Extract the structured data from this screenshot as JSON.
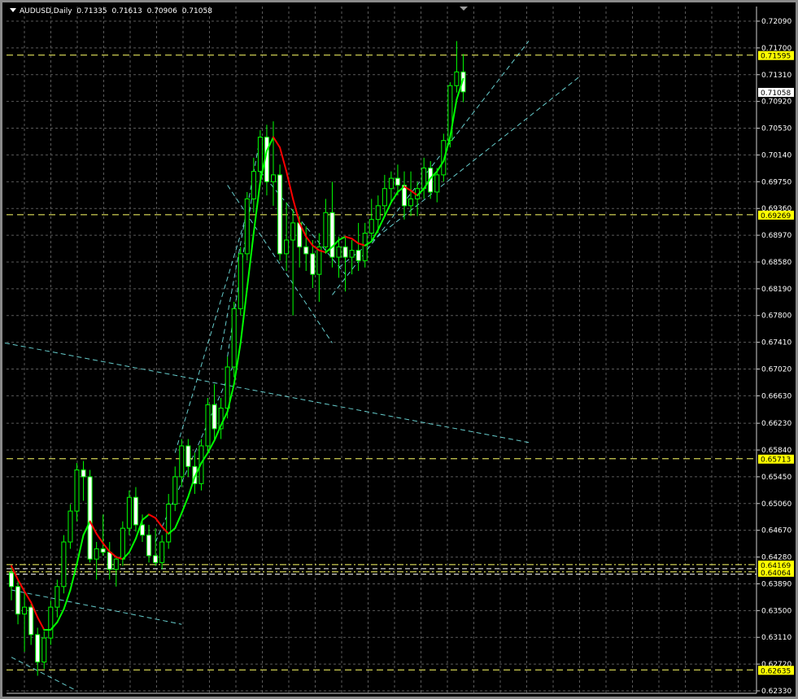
{
  "header": {
    "symbol": "AUDUSD,Daily",
    "open": "0.71335",
    "high": "0.71613",
    "low": "0.70906",
    "close": "0.71058"
  },
  "colors": {
    "background": "#000000",
    "grid": "#5a5a5a",
    "bull_candle": "#00ff00",
    "ma_up": "#00ff00",
    "ma_down": "#ff0000",
    "channel": "#66cccc",
    "hline": "#ffff66",
    "tag_bg": "#ffff00",
    "current_price_bg": "#ffffff"
  },
  "chart_data": {
    "type": "candlestick",
    "symbol": "AUDUSD",
    "timeframe": "Daily",
    "ylim": [
      0.6233,
      0.7209
    ],
    "y_ticks": [
      "0.72090",
      "0.71700",
      "0.71310",
      "0.70920",
      "0.70530",
      "0.70140",
      "0.69750",
      "0.69360",
      "0.68970",
      "0.68580",
      "0.68190",
      "0.67800",
      "0.67410",
      "0.67020",
      "0.66630",
      "0.66230",
      "0.65840",
      "0.65450",
      "0.65060",
      "0.64670",
      "0.64280",
      "0.63890",
      "0.63500",
      "0.63110",
      "0.62720",
      "0.62330"
    ],
    "y_tick_values": [
      0.7209,
      0.717,
      0.7131,
      0.7092,
      0.7053,
      0.7014,
      0.6975,
      0.6936,
      0.6897,
      0.6858,
      0.6819,
      0.678,
      0.6741,
      0.6702,
      0.6663,
      0.6623,
      0.6584,
      0.6545,
      0.6506,
      0.6467,
      0.6428,
      0.6389,
      0.635,
      0.6311,
      0.6272,
      0.6233
    ],
    "level_tags": [
      {
        "label": "0.71595",
        "value": 0.71595,
        "style": "dashed"
      },
      {
        "label": "0.69269",
        "value": 0.69269,
        "style": "dashed"
      },
      {
        "label": "0.65713",
        "value": 0.65713,
        "style": "dashed"
      },
      {
        "label": "0.64169",
        "value": 0.64169,
        "style": "dashdot"
      },
      {
        "label": "0.64064",
        "value": 0.64064,
        "style": "dashdot"
      },
      {
        "label": "0.62635",
        "value": 0.62635,
        "style": "dashed"
      }
    ],
    "extra_level_lines": [
      0.6411,
      0.6403
    ],
    "current_price": {
      "label": "0.71058",
      "value": 0.71058
    },
    "candles": [
      [
        0.6405,
        0.6415,
        0.6365,
        0.6385
      ],
      [
        0.6385,
        0.6395,
        0.633,
        0.6345
      ],
      [
        0.6345,
        0.6375,
        0.629,
        0.6355
      ],
      [
        0.6355,
        0.636,
        0.63,
        0.6315
      ],
      [
        0.6315,
        0.6325,
        0.6255,
        0.6275
      ],
      [
        0.6275,
        0.632,
        0.6265,
        0.631
      ],
      [
        0.631,
        0.6365,
        0.63,
        0.6355
      ],
      [
        0.6355,
        0.6395,
        0.634,
        0.6385
      ],
      [
        0.6385,
        0.646,
        0.6375,
        0.645
      ],
      [
        0.645,
        0.6505,
        0.644,
        0.6495
      ],
      [
        0.6495,
        0.6565,
        0.648,
        0.6555
      ],
      [
        0.6555,
        0.6568,
        0.651,
        0.6545
      ],
      [
        0.6545,
        0.6555,
        0.642,
        0.6425
      ],
      [
        0.6425,
        0.645,
        0.6395,
        0.644
      ],
      [
        0.644,
        0.649,
        0.643,
        0.6435
      ],
      [
        0.6435,
        0.645,
        0.6395,
        0.641
      ],
      [
        0.641,
        0.643,
        0.6385,
        0.6425
      ],
      [
        0.6425,
        0.648,
        0.6415,
        0.647
      ],
      [
        0.647,
        0.6525,
        0.646,
        0.6515
      ],
      [
        0.6515,
        0.653,
        0.6465,
        0.6475
      ],
      [
        0.6475,
        0.649,
        0.645,
        0.646
      ],
      [
        0.646,
        0.6475,
        0.642,
        0.643
      ],
      [
        0.643,
        0.647,
        0.6415,
        0.642
      ],
      [
        0.642,
        0.646,
        0.641,
        0.645
      ],
      [
        0.645,
        0.652,
        0.644,
        0.6505
      ],
      [
        0.6505,
        0.656,
        0.6495,
        0.6545
      ],
      [
        0.6545,
        0.66,
        0.653,
        0.659
      ],
      [
        0.659,
        0.66,
        0.6545,
        0.656
      ],
      [
        0.656,
        0.658,
        0.652,
        0.6535
      ],
      [
        0.6535,
        0.66,
        0.6525,
        0.659
      ],
      [
        0.659,
        0.666,
        0.658,
        0.665
      ],
      [
        0.665,
        0.668,
        0.66,
        0.6615
      ],
      [
        0.6615,
        0.666,
        0.66,
        0.6645
      ],
      [
        0.6645,
        0.672,
        0.663,
        0.6705
      ],
      [
        0.6705,
        0.68,
        0.669,
        0.679
      ],
      [
        0.679,
        0.688,
        0.678,
        0.687
      ],
      [
        0.687,
        0.696,
        0.686,
        0.695
      ],
      [
        0.695,
        0.701,
        0.693,
        0.699
      ],
      [
        0.699,
        0.705,
        0.697,
        0.704
      ],
      [
        0.704,
        0.7058,
        0.6955,
        0.6975
      ],
      [
        0.6975,
        0.7063,
        0.694,
        0.6985
      ],
      [
        0.6985,
        0.7,
        0.686,
        0.687
      ],
      [
        0.687,
        0.6945,
        0.6845,
        0.689
      ],
      [
        0.689,
        0.6935,
        0.678,
        0.6915
      ],
      [
        0.6915,
        0.6925,
        0.685,
        0.688
      ],
      [
        0.688,
        0.691,
        0.6845,
        0.687
      ],
      [
        0.687,
        0.689,
        0.682,
        0.684
      ],
      [
        0.684,
        0.69,
        0.68,
        0.688
      ],
      [
        0.688,
        0.695,
        0.687,
        0.693
      ],
      [
        0.693,
        0.6975,
        0.685,
        0.6865
      ],
      [
        0.6865,
        0.6895,
        0.6835,
        0.688
      ],
      [
        0.688,
        0.6895,
        0.6815,
        0.6865
      ],
      [
        0.6865,
        0.689,
        0.684,
        0.6875
      ],
      [
        0.6875,
        0.6915,
        0.6845,
        0.686
      ],
      [
        0.686,
        0.6915,
        0.685,
        0.69
      ],
      [
        0.69,
        0.695,
        0.689,
        0.692
      ],
      [
        0.692,
        0.6955,
        0.69,
        0.694
      ],
      [
        0.694,
        0.6985,
        0.6925,
        0.6965
      ],
      [
        0.6965,
        0.699,
        0.6945,
        0.698
      ],
      [
        0.698,
        0.7,
        0.6955,
        0.697
      ],
      [
        0.697,
        0.699,
        0.692,
        0.694
      ],
      [
        0.694,
        0.699,
        0.6925,
        0.695
      ],
      [
        0.695,
        0.6975,
        0.6925,
        0.6965
      ],
      [
        0.6965,
        0.701,
        0.695,
        0.6995
      ],
      [
        0.6995,
        0.7005,
        0.695,
        0.696
      ],
      [
        0.696,
        0.6995,
        0.6945,
        0.6985
      ],
      [
        0.6985,
        0.7045,
        0.6975,
        0.7035
      ],
      [
        0.7035,
        0.712,
        0.7025,
        0.7115
      ],
      [
        0.7115,
        0.718,
        0.7105,
        0.7135
      ],
      [
        0.7135,
        0.7161,
        0.7091,
        0.7106
      ]
    ],
    "moving_average": [
      0.6415,
      0.6395,
      0.6378,
      0.6362,
      0.634,
      0.6322,
      0.6322,
      0.6333,
      0.6352,
      0.638,
      0.6418,
      0.646,
      0.648,
      0.6462,
      0.6448,
      0.6436,
      0.6428,
      0.6425,
      0.6435,
      0.6455,
      0.6482,
      0.649,
      0.6485,
      0.6472,
      0.6462,
      0.647,
      0.6492,
      0.6516,
      0.6545,
      0.6565,
      0.658,
      0.6598,
      0.662,
      0.664,
      0.668,
      0.674,
      0.682,
      0.69,
      0.6975,
      0.702,
      0.704,
      0.7025,
      0.699,
      0.695,
      0.6915,
      0.6895,
      0.6882,
      0.6875,
      0.6872,
      0.688,
      0.689,
      0.6895,
      0.6892,
      0.6885,
      0.6882,
      0.6888,
      0.6905,
      0.6925,
      0.6945,
      0.696,
      0.6968,
      0.6962,
      0.6955,
      0.6965,
      0.698,
      0.699,
      0.7005,
      0.704,
      0.7095,
      0.7125
    ]
  }
}
